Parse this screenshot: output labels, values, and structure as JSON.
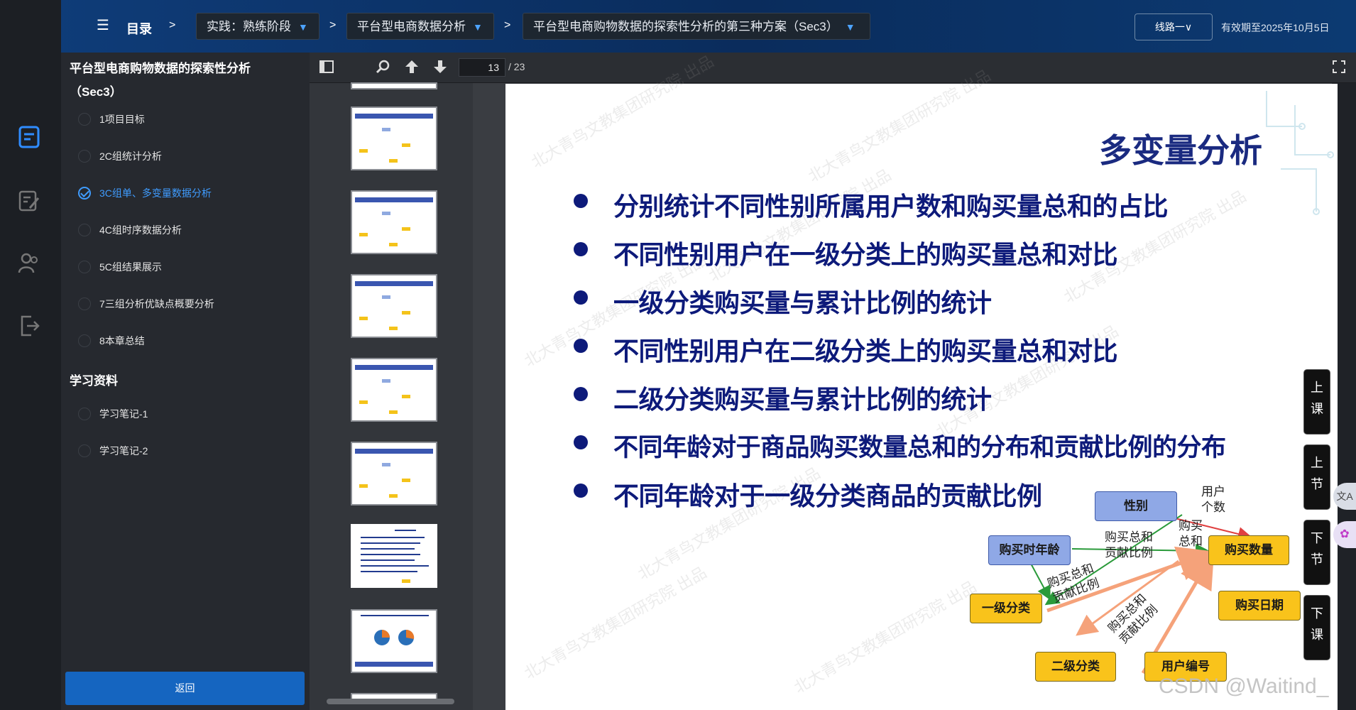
{
  "header": {
    "toc_label": "目录",
    "separator": ">",
    "crumbs": [
      "实践：熟练阶段",
      "平台型电商数据分析",
      "平台型电商购物数据的探索性分析的第三种方案（Sec3）"
    ],
    "route_button": "线路一∨",
    "expire_text": "有效期至2025年10月5日"
  },
  "outline": {
    "title": "平台型电商购物数据的探索性分析（Sec3）",
    "items": [
      {
        "label": "1项目目标"
      },
      {
        "label": "2C组统计分析"
      },
      {
        "label": "3C组单、多变量数据分析"
      },
      {
        "label": "4C组时序数据分析"
      },
      {
        "label": "5C组结果展示"
      },
      {
        "label": "7三组分析优缺点概要分析"
      },
      {
        "label": "8本章总结"
      }
    ],
    "section2_title": "学习资料",
    "materials": [
      {
        "label": "学习笔记-1"
      },
      {
        "label": "学习笔记-2"
      }
    ],
    "back_button": "返回"
  },
  "viewer": {
    "current_page": "13",
    "total_pages": "/ 23"
  },
  "slide": {
    "title": "多变量分析",
    "bullets": [
      "分别统计不同性别所属用户数和购买量总和的占比",
      "不同性别用户在一级分类上的购买量总和对比",
      "一级分类购买量与累计比例的统计",
      "不同性别用户在二级分类上的购买量总和对比",
      "二级分类购买量与累计比例的统计",
      "不同年龄对于商品购买数量总和的分布和贡献比例的分布",
      "不同年龄对于一级分类商品的贡献比例"
    ],
    "diagram": {
      "nodes": {
        "gender": "性别",
        "age": "购买时年龄",
        "qty": "购买数量",
        "cat1": "一级分类",
        "date": "购买日期",
        "cat2": "二级分类",
        "uid": "用户编号"
      },
      "labels": {
        "user_count": "用户\n个数",
        "buy_total": "购买\n总和",
        "total_contrib": "购买总和\n贡献比例",
        "total_contrib2": "购买总和\n贡献比例",
        "total_contrib3": "购买总和\n贡献比例"
      }
    },
    "watermark": "北大青鸟文教集团研究院 出品"
  },
  "side_controls": [
    "上\n课",
    "上\n节",
    "下\n节",
    "下\n课"
  ],
  "footer_mark": "CSDN @Waitind_",
  "colors": {
    "accent": "#3f9cff",
    "slide_text": "#0d1a7a",
    "node_yellow": "#f9c31b",
    "node_blue": "#8fa8e6",
    "arrow_orange": "#f5a27a"
  }
}
